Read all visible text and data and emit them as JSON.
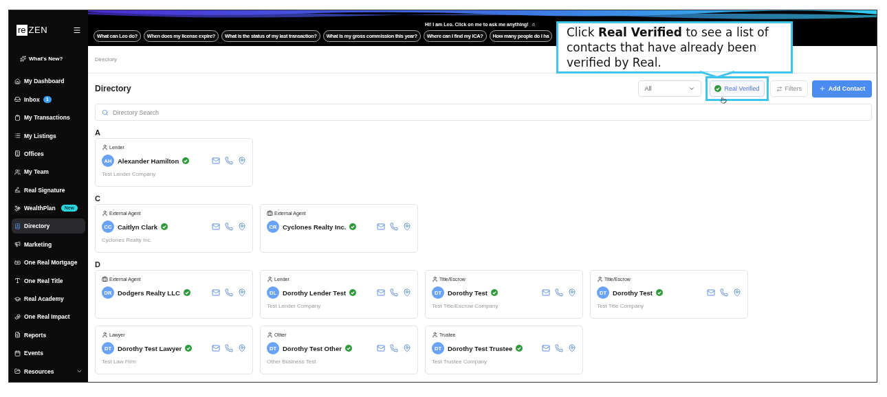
{
  "logo": {
    "mark": "re",
    "name": "ZEN"
  },
  "whats_new": "What's New?",
  "sidebar": {
    "items": [
      {
        "label": "My Dashboard",
        "selected": false
      },
      {
        "label": "Inbox",
        "selected": false,
        "badge": "1"
      },
      {
        "label": "My Transactions",
        "selected": false
      },
      {
        "label": "My Listings",
        "selected": false
      },
      {
        "label": "Offices",
        "selected": false
      },
      {
        "label": "My Team",
        "selected": false
      },
      {
        "label": "Real Signature",
        "selected": false
      },
      {
        "label": "WealthPlan",
        "selected": false,
        "tag": "New"
      },
      {
        "label": "Directory",
        "selected": true
      },
      {
        "label": "Marketing",
        "selected": false
      },
      {
        "label": "One Real Mortgage",
        "selected": false
      },
      {
        "label": "One Real Title",
        "selected": false
      },
      {
        "label": "Real Academy",
        "selected": false
      },
      {
        "label": "One Real Impact",
        "selected": false
      },
      {
        "label": "Reports",
        "selected": false
      },
      {
        "label": "Events",
        "selected": false
      },
      {
        "label": "Resources",
        "selected": false,
        "expandable": true
      }
    ]
  },
  "assistant": {
    "prompt": "Hi! I am Leo. Click on me to ask me anything!",
    "suggestions": [
      "What can Leo do?",
      "When does my license expire?",
      "What is the status of my last transaction?",
      "What is my gross commission this year?",
      "Where can I find my ICA?",
      "How many people do I ha"
    ]
  },
  "breadcrumb": "Directory",
  "page_title": "Directory",
  "toolbar": {
    "filter_value": "All",
    "verified": {
      "label": "Real Verified",
      "selected": false
    },
    "filters": "Filters",
    "add": "Add Contact"
  },
  "search": {
    "placeholder": "Directory Search"
  },
  "sections": [
    {
      "letter": "A",
      "contacts": [
        {
          "kind": "person",
          "role": "Lender",
          "initials": "AH",
          "name": "Alexander Hamilton",
          "verified": true,
          "company": "Test Lender Company"
        }
      ]
    },
    {
      "letter": "C",
      "contacts": [
        {
          "kind": "person",
          "role": "External Agent",
          "initials": "CC",
          "name": "Caitlyn Clark",
          "verified": true,
          "company": "Cyclones Realty Inc."
        },
        {
          "kind": "business",
          "role": "External Agent",
          "initials": "CR",
          "name": "Cyclones Realty Inc.",
          "verified": true
        }
      ]
    },
    {
      "letter": "D",
      "contacts": [
        {
          "kind": "business",
          "role": "External Agent",
          "initials": "DR",
          "name": "Dodgers Realty LLC",
          "verified": true
        },
        {
          "kind": "person",
          "role": "Lender",
          "initials": "DL",
          "name": "Dorothy Lender Test",
          "verified": true,
          "company": "Test Lender Company"
        },
        {
          "kind": "person",
          "role": "Title/Escrow",
          "initials": "DT",
          "name": "Dorothy Test",
          "verified": true,
          "company": "Test Title/Escrow Company"
        },
        {
          "kind": "person",
          "role": "Title/Escrow",
          "initials": "DT",
          "name": "Dorothy Test",
          "verified": true,
          "company": "Test Title Company"
        },
        {
          "kind": "person",
          "role": "Lawyer",
          "initials": "DT",
          "name": "Dorothy Test Lawyer",
          "verified": true,
          "company": "Test Law Firm"
        },
        {
          "kind": "person",
          "role": "Other",
          "initials": "DT",
          "name": "Dorothy Test Other",
          "verified": true,
          "company": "Other Business Test"
        },
        {
          "kind": "person",
          "role": "Trustee",
          "initials": "DT",
          "name": "Dorothy Test Trustee",
          "verified": true,
          "company": "Test Trustee Company"
        }
      ]
    }
  ],
  "callout": "Click **Real Verified** to see a list of contacts that have already been verified by Real."
}
